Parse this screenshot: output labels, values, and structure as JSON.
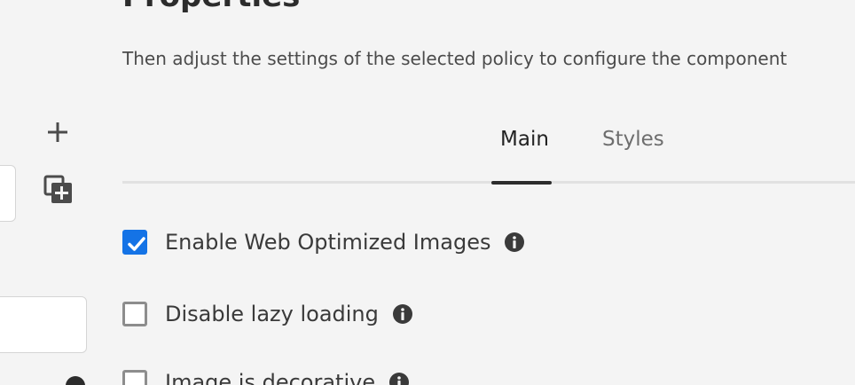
{
  "header": {
    "title": "Properties",
    "subtitle": "Then adjust the settings of the selected policy to configure the component"
  },
  "left_panel": {
    "add_icon": "plus-icon",
    "duplicate_icon": "duplicate-add-icon"
  },
  "tabs": [
    {
      "label": "Main",
      "selected": true
    },
    {
      "label": "Styles",
      "selected": false
    }
  ],
  "options": [
    {
      "label": "Enable Web Optimized Images",
      "checked": true,
      "info_icon": "info-icon"
    },
    {
      "label": "Disable lazy loading",
      "checked": false,
      "info_icon": "info-icon"
    },
    {
      "label": "Image is decorative",
      "checked": false,
      "info_icon": "info-icon"
    }
  ],
  "colors": {
    "accent": "#1473e6",
    "background": "#f4f4f4",
    "text": "#2c2c2c"
  }
}
